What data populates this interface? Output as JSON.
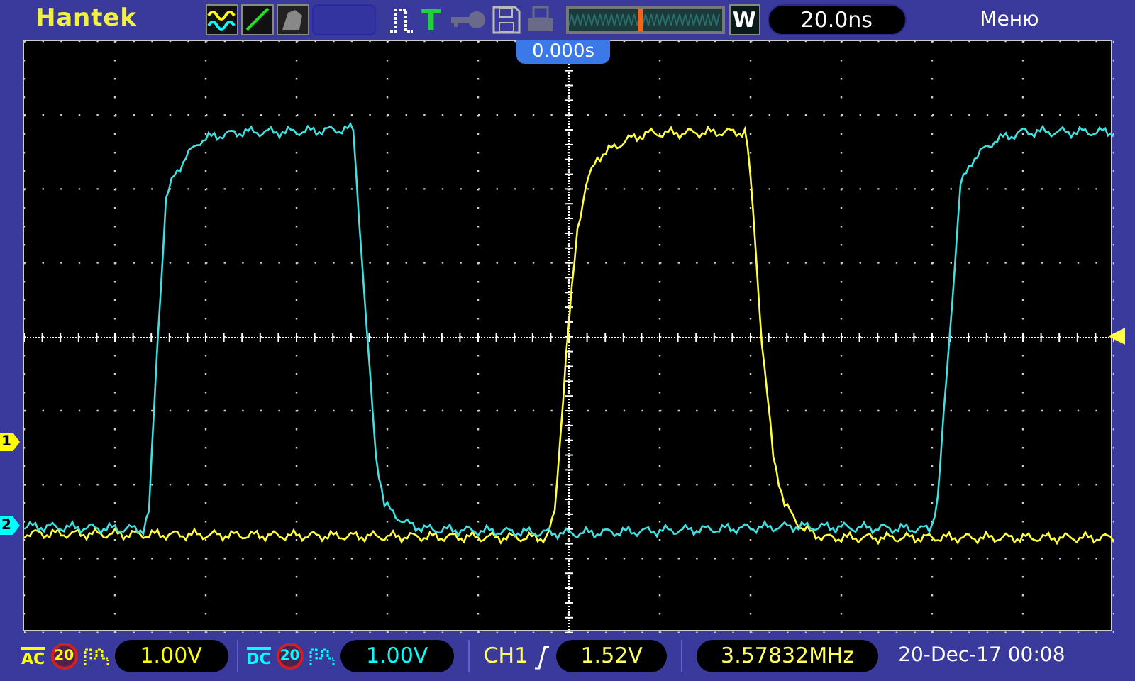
{
  "brand": "Hantek",
  "toolbar": {
    "trigger_letter": "T"
  },
  "memory_bar": {
    "level": 0.46
  },
  "zoom_button": "W",
  "timebase": "20.0ns",
  "menu": "Меню",
  "time_marker": "0.000s",
  "channel_markers": [
    {
      "label": "1",
      "color": "#ffff00"
    },
    {
      "label": "2",
      "color": "#00ffff"
    }
  ],
  "channels": [
    {
      "coupling": "AC",
      "bandwidth_limit": "20",
      "volts_per_div": "1.00V",
      "color": "#ffff00"
    },
    {
      "coupling": "DC",
      "bandwidth_limit": "20",
      "volts_per_div": "1.00V",
      "color": "#00ffff"
    }
  ],
  "trigger": {
    "source": "CH1",
    "trigger_level": "1.52V"
  },
  "frequency": "3.57832MHz",
  "datetime": "20-Dec-17 00:08"
}
